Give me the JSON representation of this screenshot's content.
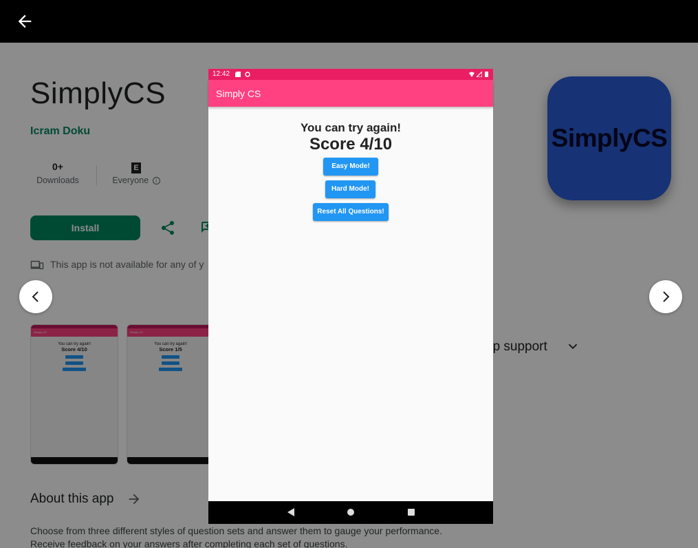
{
  "store": {
    "app_title": "SimplyCS",
    "developer": "Icram Doku",
    "downloads_value": "0+",
    "downloads_label": "Downloads",
    "rating_badge": "E",
    "rating_label": "Everyone",
    "install_label": "Install",
    "availability_text": "This app is not available for any of y",
    "app_icon_text": "SimplyCS",
    "support_label": "pp support",
    "about_label": "About this app",
    "description": "Choose from three different styles of question sets and answer them to gauge your performance. Receive feedback on your answers after completing each set of questions."
  },
  "screenshots": [
    {
      "bar": "Simply CS",
      "line1": "You can try again!",
      "line2": "Score 4/10"
    },
    {
      "bar": "Simply CS",
      "line1": "You can try again!",
      "line2": "Score 1/5"
    }
  ],
  "phone": {
    "time": "12:42",
    "appbar_title": "Simply CS",
    "message": "You can try again!",
    "score": "Score 4/10",
    "buttons": {
      "easy": "Easy Mode!",
      "hard": "Hard Mode!",
      "reset": "Reset All Questions!"
    }
  },
  "icons": [
    "back-arrow-icon",
    "share-icon",
    "wishlist-icon",
    "devices-icon",
    "chevron-left-icon",
    "chevron-right-icon",
    "chevron-down-icon",
    "arrow-right-icon"
  ],
  "colors": {
    "accent_green": "#01875f",
    "phone_appbar": "#ff4081",
    "phone_statusbar": "#e91e63",
    "phone_button": "#2196f3",
    "app_icon_bg": "#2b5bd6"
  }
}
